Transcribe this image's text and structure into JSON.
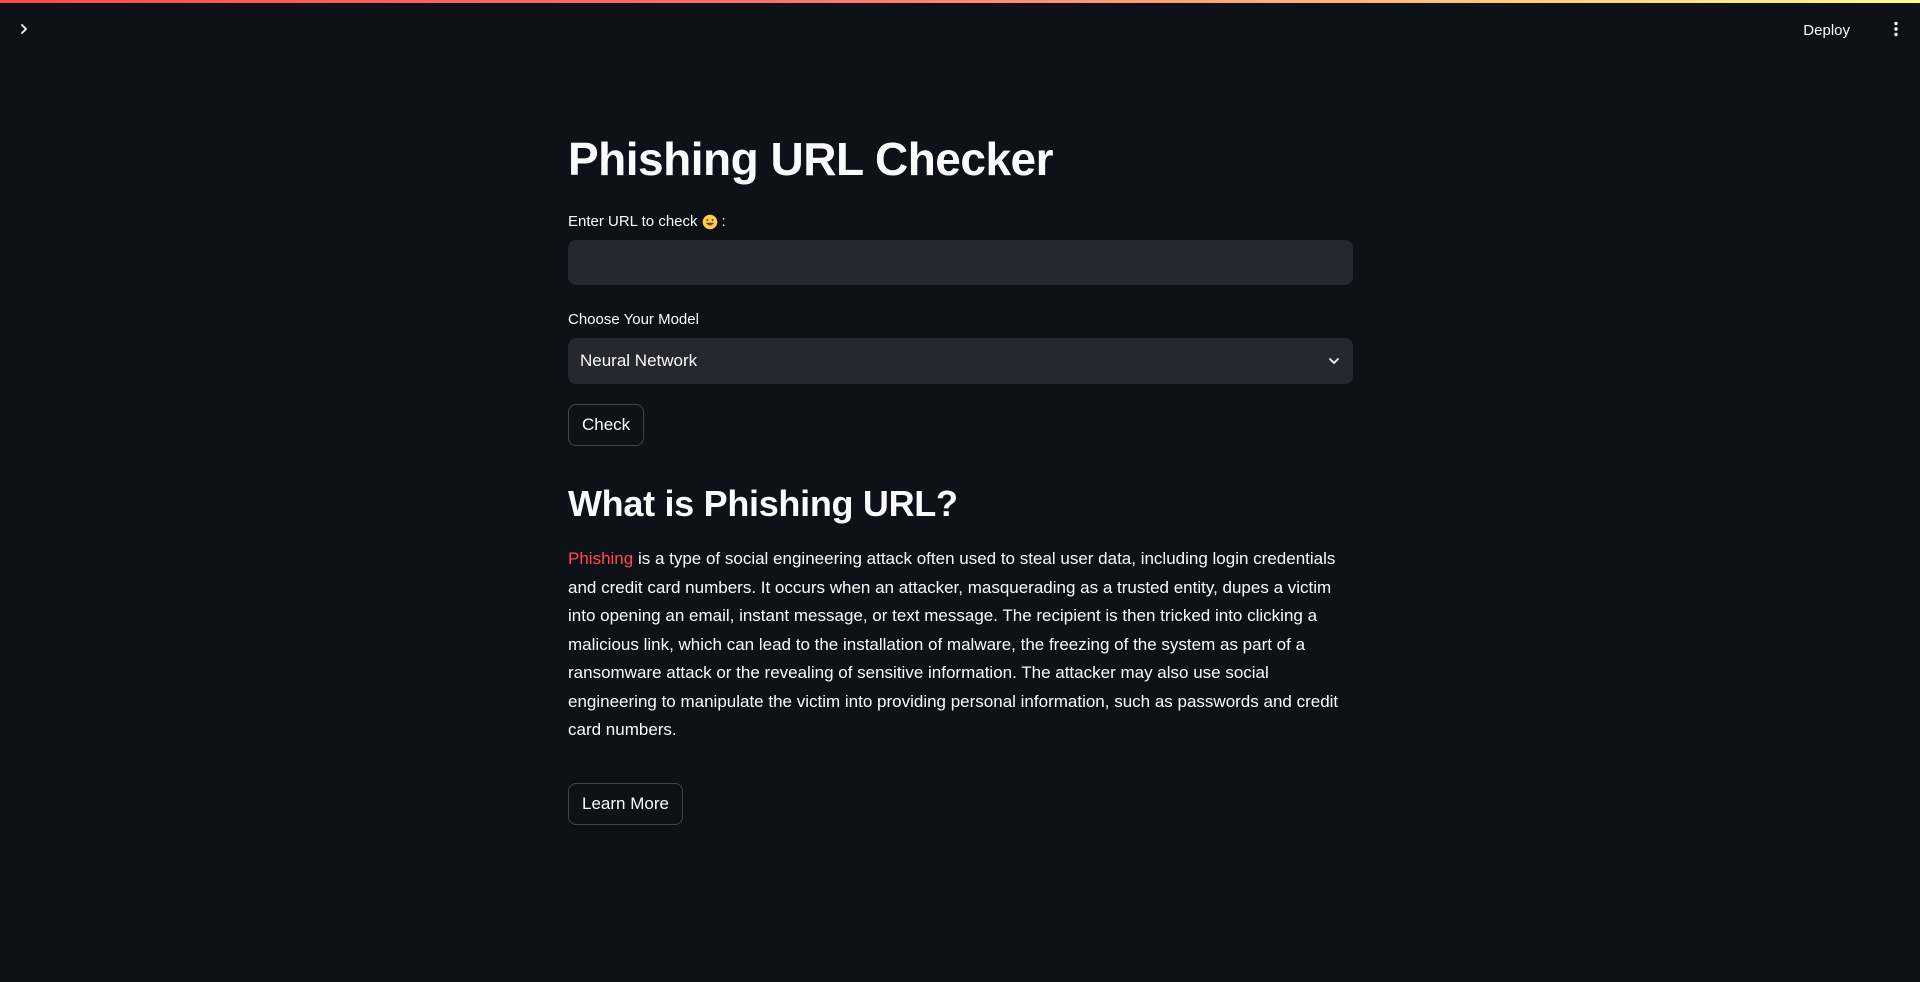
{
  "header": {
    "deploy_label": "Deploy"
  },
  "page": {
    "title": "Phishing URL Checker"
  },
  "url_input": {
    "label": "Enter URL to check",
    "label_suffix": ":",
    "value": "",
    "placeholder": ""
  },
  "model_select": {
    "label": "Choose Your Model",
    "selected": "Neural Network"
  },
  "check_button": {
    "label": "Check"
  },
  "info": {
    "heading": "What is Phishing URL?",
    "highlight_word": "Phishing",
    "body": " is a type of social engineering attack often used to steal user data, including login credentials and credit card numbers. It occurs when an attacker, masquerading as a trusted entity, dupes a victim into opening an email, instant message, or text message. The recipient is then tricked into clicking a malicious link, which can lead to the installation of malware, the freezing of the system as part of a ransomware attack or the revealing of sensitive information. The attacker may also use social engineering to manipulate the victim into providing personal information, such as passwords and credit card numbers.",
    "learn_more_label": "Learn More"
  },
  "colors": {
    "background": "#0e1117",
    "input_bg": "#262730",
    "accent": "#ff4b4b",
    "text": "#fafafa"
  },
  "icons": {
    "sidebar_toggle": "chevron-right-icon",
    "main_menu": "vertical-ellipsis-icon",
    "select_arrow": "chevron-down-icon",
    "label_emoji": "grinning-face-emoji-icon"
  }
}
